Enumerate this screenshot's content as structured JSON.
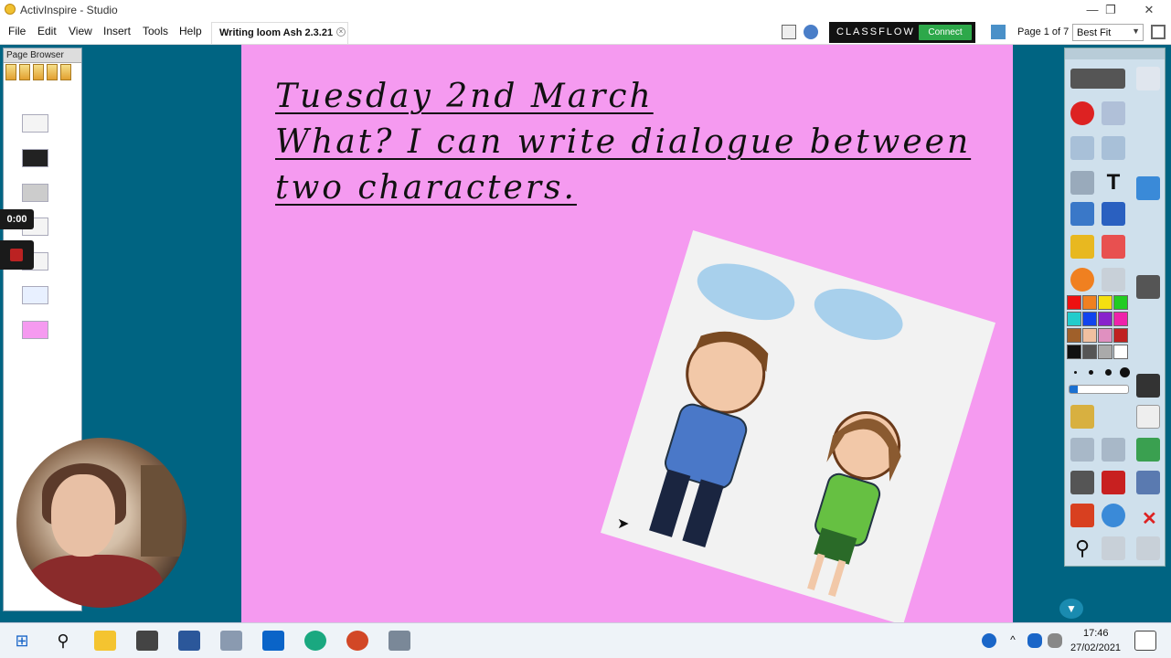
{
  "app": {
    "title": "ActivInspire - Studio",
    "minimize": "—",
    "restore": "❐",
    "close": "✕"
  },
  "menu": {
    "items": [
      "File",
      "Edit",
      "View",
      "Insert",
      "Tools",
      "Help"
    ],
    "doc_tab": "Writing loom Ash 2.3.21",
    "doc_tab_close": "×"
  },
  "toolbar_right": {
    "classflow": "CLASSFLOW",
    "connect": "Connect",
    "page_indicator": "Page 1 of 7",
    "zoom_mode": "Best Fit"
  },
  "page_browser": {
    "title": "Page Browser",
    "thumbs": 7
  },
  "recorder": {
    "timer": "0:00"
  },
  "slide": {
    "line1": "Tuesday 2nd March",
    "line2": "What? I can write dialogue between",
    "line3": "two characters.",
    "background": "#f59af0"
  },
  "toolbox": {
    "colors": [
      "#ee1111",
      "#f08020",
      "#f4e010",
      "#22cc22",
      "#22cccc",
      "#1144ee",
      "#8822cc",
      "#ee22aa",
      "#a0602a",
      "#f0c0a0",
      "#e090c0",
      "#c02020",
      "#111111",
      "#555555",
      "#aaaaaa",
      "#ffffff"
    ]
  },
  "taskbar": {
    "time": "17:46",
    "date": "27/02/2021"
  }
}
